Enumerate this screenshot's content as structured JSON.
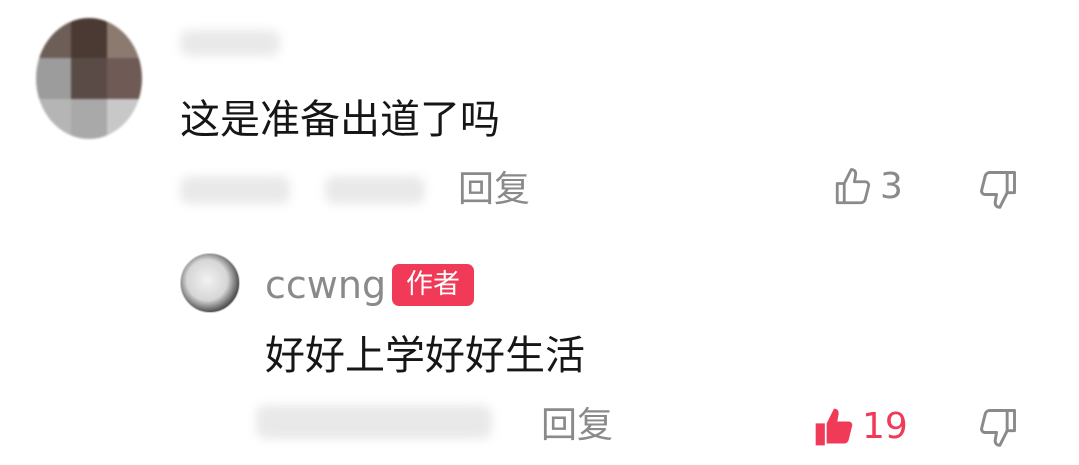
{
  "comment": {
    "text": "这是准备出道了吗",
    "reply_label": "回复",
    "like_count": "3",
    "colors": {
      "text": "#161616",
      "meta": "#8a8a8a"
    },
    "icons": {
      "like": "thumbs-up-outline-icon",
      "dislike": "thumbs-down-outline-icon"
    }
  },
  "reply": {
    "username": "ccwng",
    "author_badge": "作者",
    "text": "好好上学好好生活",
    "reply_label": "回复",
    "like_count": "19",
    "liked": true,
    "colors": {
      "badge": "#f03a57",
      "liked": "#f03a57"
    },
    "icons": {
      "like": "thumbs-up-filled-icon",
      "dislike": "thumbs-down-outline-icon"
    }
  }
}
